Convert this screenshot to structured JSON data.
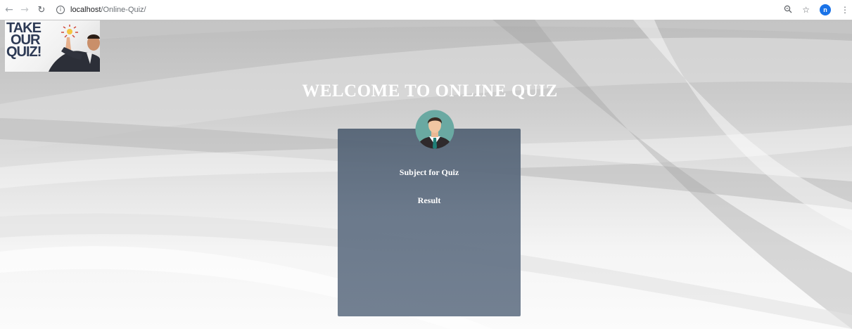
{
  "browser": {
    "url_host": "localhost",
    "url_path": "/Online-Quiz/",
    "profile_initial": "n"
  },
  "logo": {
    "lines": [
      "TAKE",
      "OUR",
      "QUIZ!"
    ]
  },
  "page": {
    "title": "WELCOME TO ONLINE QUIZ"
  },
  "menu": {
    "items": [
      {
        "label": "Subject for Quiz"
      },
      {
        "label": "Result"
      }
    ]
  },
  "colors": {
    "card": "#5e6c80",
    "avatar_bg": "#6aa9a2",
    "profile": "#1a73e8"
  }
}
